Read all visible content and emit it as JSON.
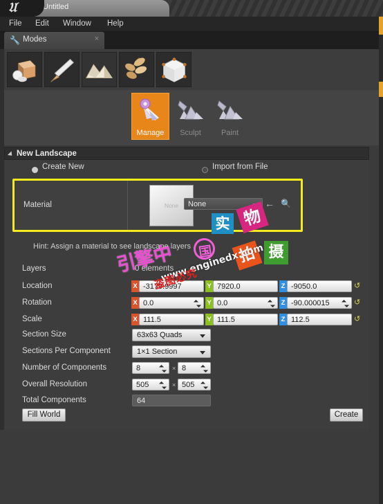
{
  "window": {
    "title": "Untitled",
    "logo_icon": "unreal-engine-logo"
  },
  "menubar": {
    "items": [
      {
        "label": "File"
      },
      {
        "label": "Edit"
      },
      {
        "label": "Window"
      },
      {
        "label": "Help"
      }
    ]
  },
  "modes_tab": {
    "label": "Modes",
    "icon": "wrench-icon",
    "close_icon": "×"
  },
  "mode_buttons": [
    {
      "name": "place-mode",
      "tooltip": "Place"
    },
    {
      "name": "paint-mode",
      "tooltip": "Paint"
    },
    {
      "name": "landscape-mode",
      "tooltip": "Landscape"
    },
    {
      "name": "foliage-mode",
      "tooltip": "Foliage"
    },
    {
      "name": "geometry-mode",
      "tooltip": "Geometry Editing"
    }
  ],
  "tool_tabs": [
    {
      "label": "Manage",
      "active": true
    },
    {
      "label": "Sculpt",
      "active": false
    },
    {
      "label": "Paint",
      "active": false
    }
  ],
  "section": {
    "title": "New Landscape",
    "collapse_icon": "triangle-down-icon"
  },
  "mode_options": {
    "create_new": {
      "label": "Create New",
      "selected": true
    },
    "import_from_file": {
      "label": "Import from File",
      "selected": false
    }
  },
  "material": {
    "label": "Material",
    "thumbnail_text": "None",
    "combo_value": "None",
    "back_icon": "back-arrow-icon",
    "browse_icon": "browse-magnifier-icon"
  },
  "hint": {
    "text": "Hint: Assign a material to see landscape layers"
  },
  "layers": {
    "label": "Layers",
    "value": "0 elements"
  },
  "transform": {
    "location": {
      "label": "Location",
      "x": "-3179.9997",
      "y": "7920.0",
      "z": "-9050.0"
    },
    "rotation": {
      "label": "Rotation",
      "x": "0.0",
      "y": "0.0",
      "z": "-90.000015"
    },
    "scale": {
      "label": "Scale",
      "x": "111.5",
      "y": "111.5",
      "z": "112.5"
    },
    "axis_labels": {
      "x": "X",
      "y": "Y",
      "z": "Z"
    },
    "axis_colors": {
      "x": "#d9532c",
      "y": "#8bc020",
      "z": "#2f8fe0"
    },
    "reset_icon": "reset-arrow-icon"
  },
  "properties": {
    "section_size": {
      "label": "Section Size",
      "value": "63x63 Quads"
    },
    "sections_per_component": {
      "label": "Sections Per Component",
      "value": "1×1 Section"
    },
    "number_of_components": {
      "label": "Number of Components",
      "x": "8",
      "y": "8",
      "separator": "×"
    },
    "overall_resolution": {
      "label": "Overall Resolution",
      "x": "505",
      "y": "505",
      "separator": "×"
    },
    "total_components": {
      "label": "Total Components",
      "value": "64"
    }
  },
  "footer": {
    "fill_world_label": "Fill World",
    "create_label": "Create"
  },
  "watermark": {
    "brand_cn": "引擎",
    "brand_cn2": "中",
    "brand_cn3": "国",
    "url": "www.enginedx.com",
    "red_text": "盗图必究",
    "badge_blue": "实",
    "badge_pink": "物",
    "badge_orange": "拍",
    "badge_green": "摄"
  },
  "colors": {
    "accent_orange": "#e8861a",
    "highlight_yellow": "#f5ea1e",
    "panel_bg": "#3d3d3d",
    "edge_accent": "#e3a429"
  }
}
